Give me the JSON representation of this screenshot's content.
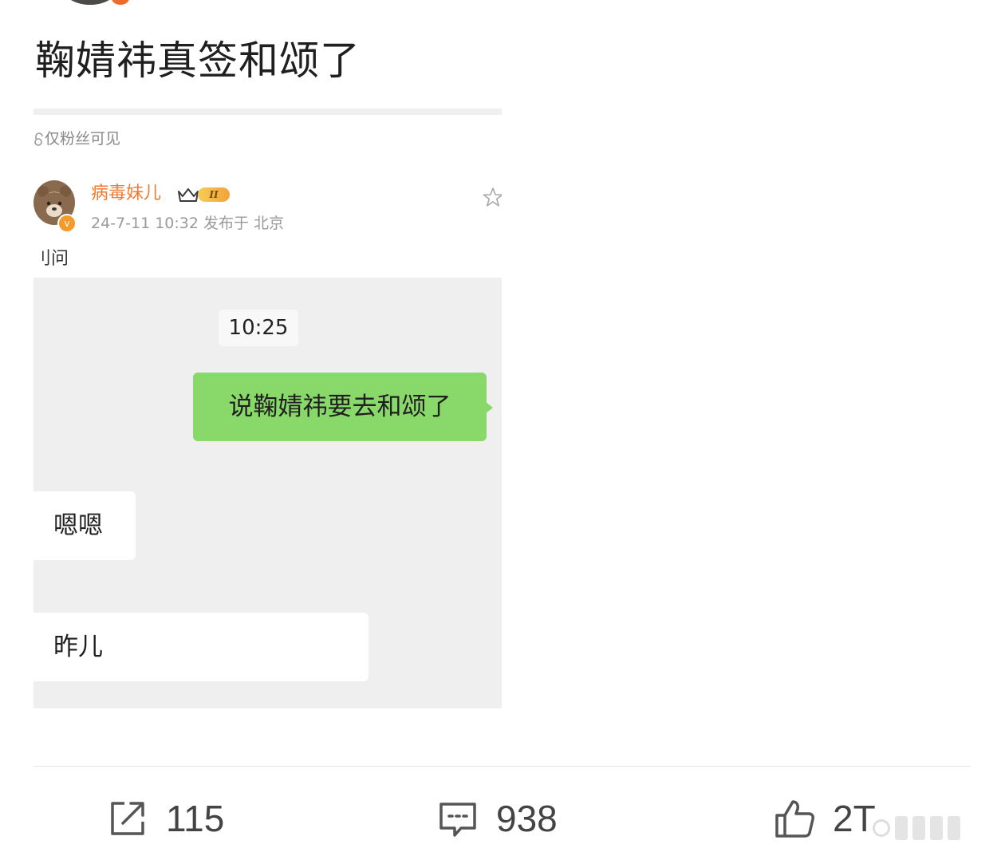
{
  "post": {
    "title": "鞠婧祎真签和颂了"
  },
  "screenshot": {
    "visibility": "仅粉丝可见",
    "username": "病毒妹儿",
    "vip_level": "II",
    "meta": "24-7-11 10:32  发布于 北京",
    "content_fragment": "刂问",
    "chat": {
      "time": "10:25",
      "sent_message": "说鞠婧祎要去和颂了",
      "reply_1": "嗯嗯",
      "reply_2": "昨儿"
    }
  },
  "actions": {
    "share_count": "115",
    "comment_count": "938",
    "like_count": "2T"
  },
  "icons": {
    "share": "share-icon",
    "comment": "comment-icon",
    "like": "thumbs-up-icon",
    "star": "star-icon",
    "lock": "lock-icon",
    "crown": "crown-icon"
  },
  "colors": {
    "username": "#f07a30",
    "chat_green": "#89d96a",
    "chat_bg": "#efefef"
  }
}
